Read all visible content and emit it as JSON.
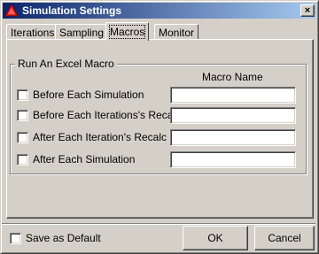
{
  "window": {
    "title": "Simulation Settings",
    "close_symbol": "×",
    "icon": "triangle-app-icon"
  },
  "tabs": [
    {
      "label": "Iterations",
      "active": false
    },
    {
      "label": "Sampling",
      "active": false
    },
    {
      "label": "Macros",
      "active": true
    },
    {
      "label": "Monitor",
      "active": false
    }
  ],
  "macros": {
    "group_title": "Run An Excel Macro",
    "column_header": "Macro Name",
    "rows": [
      {
        "label": "Before Each Simulation",
        "checked": false,
        "macro_name": ""
      },
      {
        "label": "Before Each Iterations's Recalc",
        "checked": false,
        "macro_name": ""
      },
      {
        "label": "After Each Iteration's Recalc",
        "checked": false,
        "macro_name": ""
      },
      {
        "label": "After Each Simulation",
        "checked": false,
        "macro_name": ""
      }
    ]
  },
  "footer": {
    "save_default_label": "Save as Default",
    "save_default_checked": false,
    "ok_label": "OK",
    "cancel_label": "Cancel"
  },
  "colors": {
    "title_start": "#0a246a",
    "title_end": "#a6caf0",
    "face": "#d4d0c8",
    "app_icon": "#e02020"
  }
}
